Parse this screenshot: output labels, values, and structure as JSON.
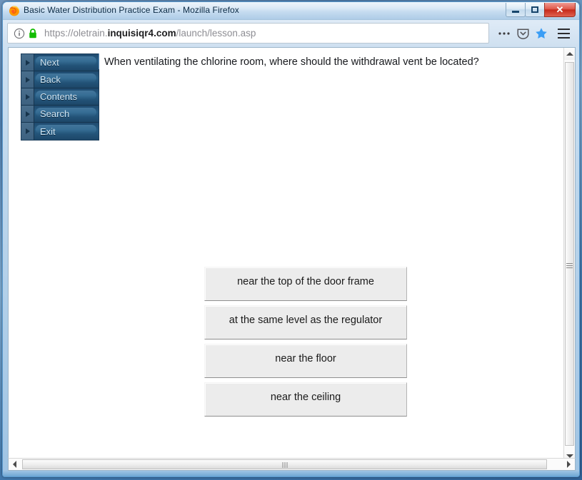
{
  "window": {
    "title": "Basic Water Distribution Practice Exam - Mozilla Firefox",
    "minimize_label": "Minimize",
    "maximize_label": "Maximize",
    "close_label": "✕"
  },
  "browser": {
    "url_prefix": "https://oletrain.",
    "url_host": "inquisiqr4.com",
    "url_path": "/launch/lesson.asp",
    "url_full": "https://oletrain.inquisiqr4.com/launch/lesson.asp",
    "identity_icon": "info-circle-icon",
    "lock_icon": "padlock-icon",
    "page_actions_icon": "ellipsis-icon",
    "pocket_icon": "pocket-icon",
    "bookmark_icon": "star-icon",
    "menu_icon": "hamburger-menu-icon"
  },
  "lesson": {
    "nav": [
      {
        "label": "Next"
      },
      {
        "label": "Back"
      },
      {
        "label": "Contents"
      },
      {
        "label": "Search"
      },
      {
        "label": "Exit"
      }
    ],
    "question": "When ventilating the chlorine room, where should the withdrawal vent be located?",
    "answers": [
      {
        "label": "near the top of the door frame"
      },
      {
        "label": "at the same level as the regulator"
      },
      {
        "label": "near the floor"
      },
      {
        "label": "near the ceiling"
      }
    ]
  },
  "colors": {
    "nav_button_bg": "#275d84",
    "nav_button_text": "#cfe6f5",
    "answer_bg": "#ececec",
    "bookmark_star": "#3b9ef5",
    "lock_green": "#12bc00",
    "close_red": "#c5291a"
  }
}
